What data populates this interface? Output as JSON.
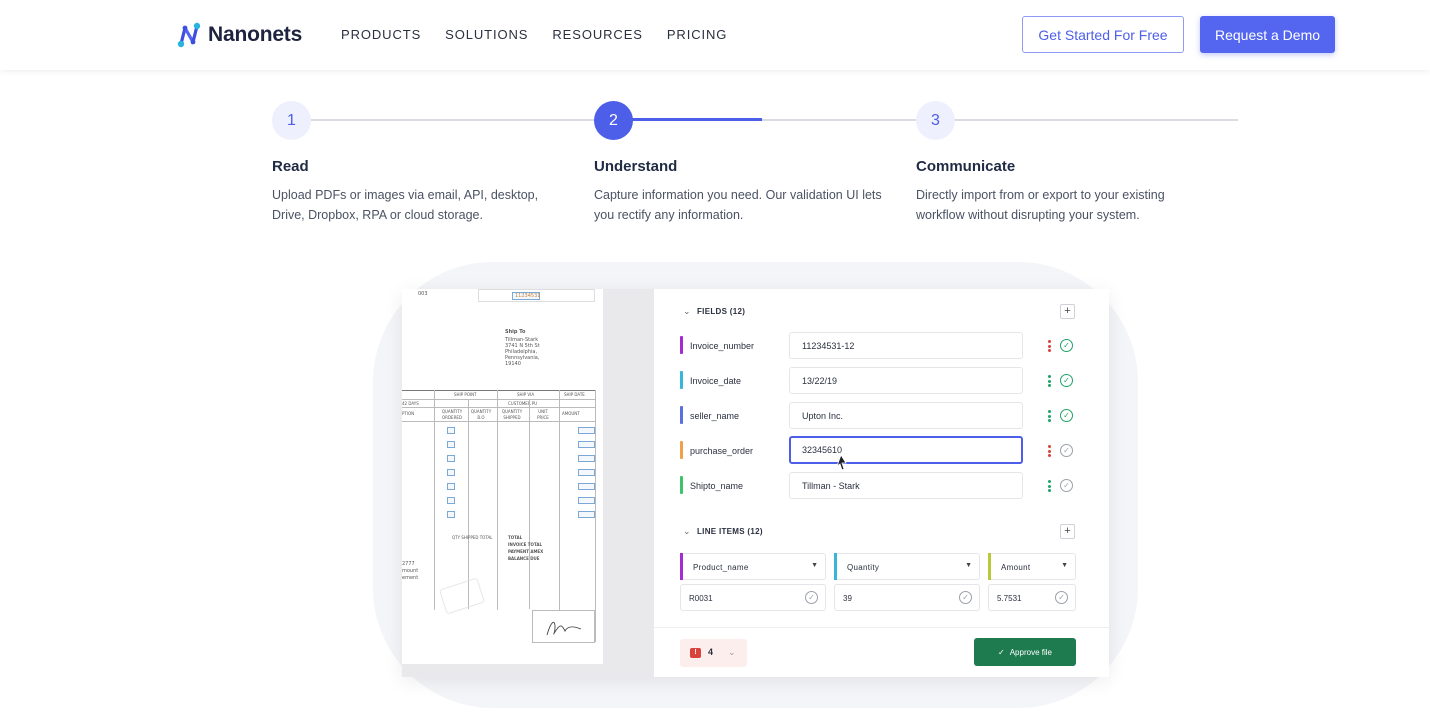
{
  "brand": {
    "name": "Nanonets"
  },
  "nav": {
    "links": [
      "PRODUCTS",
      "SOLUTIONS",
      "RESOURCES",
      "PRICING"
    ],
    "cta_secondary": "Get Started For Free",
    "cta_primary": "Request a Demo"
  },
  "steps": [
    {
      "number": "1",
      "title": "Read",
      "desc": "Upload PDFs or images via email, API, desktop, Drive, Dropbox, RPA or cloud storage.",
      "active": false
    },
    {
      "number": "2",
      "title": "Understand",
      "desc": "Capture information you need. Our validation UI lets you rectify any information.",
      "active": true
    },
    {
      "number": "3",
      "title": "Communicate",
      "desc": "Directly import from or export to your existing workflow without disrupting your system.",
      "active": false
    }
  ],
  "demo": {
    "document": {
      "ship_to_title": "Ship To",
      "ship_to_lines": [
        "Tillman-Stark",
        "3741 N 5th St",
        "Philadelphia,",
        "Pennsylvania,",
        "19140"
      ],
      "invoice_ref": "11234531",
      "table_headers": [
        "SHIP POINT",
        "SHIP VIA",
        "SHIP DATE"
      ],
      "col_headers": [
        "QUANTITY ORDERED",
        "QUANTITY B.O",
        "QUANTITY SHIPPED",
        "UNIT PRICE",
        "AMOUNT"
      ],
      "totals_labels": [
        "TOTAL",
        "INVOICE TOTAL",
        "PAYMENT AMEX",
        "BALANCE DUE"
      ],
      "qty_shipped_label": "QTY SHIPPED TOTAL",
      "fragment_top": "003",
      "fragment_side": [
        "2777",
        "mount",
        "ement"
      ],
      "fragment_days": "42 DAYS",
      "fragment_ption": "PTION",
      "fragment_customer": "CUSTOMER PU"
    },
    "fields_header": "FIELDS (12)",
    "fields": [
      {
        "label": "Invoice_number",
        "value": "11234531-12",
        "color": "#a22bd6",
        "status": "ok",
        "dots": "#d9433b"
      },
      {
        "label": "Invoice_date",
        "value": "13/22/19",
        "color": "#37b6d9",
        "status": "ok",
        "dots": "#21a366"
      },
      {
        "label": "seller_name",
        "value": "Upton Inc.",
        "color": "#5a6fe0",
        "status": "ok",
        "dots": "#21a366"
      },
      {
        "label": "purchase_order",
        "value": "32345610",
        "color": "#f0a04b",
        "status": "pending",
        "dots": "#d9433b"
      },
      {
        "label": "Shipto_name",
        "value": "Tillman - Stark",
        "color": "#3ec36b",
        "status": "pending",
        "dots": "#21a366"
      }
    ],
    "line_items_header": "LINE ITEMS (12)",
    "line_items": [
      {
        "name": "Product_name",
        "value": "R0031",
        "color": "#a22bd6"
      },
      {
        "name": "Quantity",
        "value": "39",
        "color": "#37b6d9"
      },
      {
        "name": "Amount",
        "value": "5.7531",
        "color": "#b8c93a"
      }
    ],
    "error_count": "4",
    "approve_label": "Approve file"
  },
  "colors": {
    "accent": "#4d5ee8",
    "success": "#1e7a4f",
    "error": "#d9433b"
  }
}
